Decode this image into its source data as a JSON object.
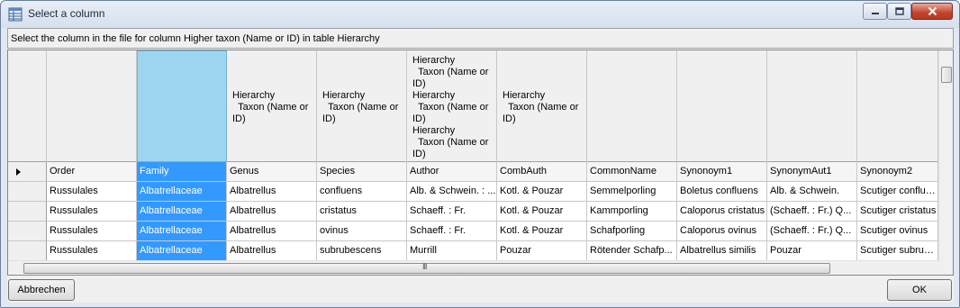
{
  "window": {
    "title": "Select a column",
    "minimize_icon": "minimize-icon",
    "maximize_icon": "maximize-icon",
    "close_icon": "close-icon",
    "title_icon": "table-icon"
  },
  "instruction": "Select the column in the file for column Higher taxon (Name or ID) in table Hierarchy",
  "mapping_headers": [
    "",
    "",
    "Hierarchy\n  Taxon (Name or\nID)",
    "Hierarchy\n  Taxon (Name or\nID)",
    "Hierarchy\n  Taxon (Name or\nID)\nHierarchy\n  Taxon (Name or\nID)\nHierarchy\n  Taxon (Name or\nID)",
    "Hierarchy\n  Taxon (Name or\nID)",
    "",
    "",
    "",
    ""
  ],
  "column_names": [
    "Order",
    "Family",
    "Genus",
    "Species",
    "Author",
    "CombAuth",
    "CommonName",
    "Synonoym1",
    "SynonymAut1",
    "Synonoym2"
  ],
  "rows": [
    [
      "Russulales",
      "Albatrellaceae",
      "Albatrellus",
      "confluens",
      "Alb. & Schwein. : ...",
      "Kotl. & Pouzar",
      "Semmelporling",
      "Boletus confluens",
      "Alb. & Schwein.",
      "Scutiger confluens"
    ],
    [
      "Russulales",
      "Albatrellaceae",
      "Albatrellus",
      "cristatus",
      "Schaeff. : Fr.",
      "Kotl. & Pouzar",
      "Kammporling",
      "Caloporus cristatus",
      "(Schaeff. : Fr.) Q...",
      "Scutiger cristatus"
    ],
    [
      "Russulales",
      "Albatrellaceae",
      "Albatrellus",
      "ovinus",
      "Schaeff. : Fr.",
      "Kotl. & Pouzar",
      "Schafporling",
      "Caloporus ovinus",
      "(Schaeff. : Fr.) Q...",
      "Scutiger ovinus"
    ],
    [
      "Russulales",
      "Albatrellaceae",
      "Albatrellus",
      "subrubescens",
      "Murrill",
      "Pouzar",
      "Rötender Schafp...",
      "Albatrellus similis",
      "Pouzar",
      "Scutiger subrube..."
    ]
  ],
  "selected_column_index": 1,
  "hscroll_glyph": "III",
  "buttons": {
    "cancel": "Abbrechen",
    "ok": "OK"
  },
  "colors": {
    "selected_cell": "#3399ff",
    "selected_header": "#9dd5f1"
  }
}
